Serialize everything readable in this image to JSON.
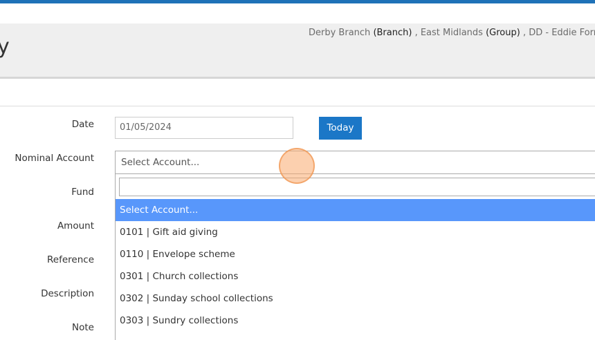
{
  "header": {
    "title_fragment": "y",
    "context": {
      "branch_name": "Derby Branch",
      "branch_tag": "(Branch)",
      "sep1": " , ",
      "group_name": "East Midlands",
      "group_tag": "(Group)",
      "sep2": " , ",
      "user": "DD - Eddie Forrest"
    }
  },
  "form": {
    "labels": {
      "date": "Date",
      "nominal_account": "Nominal Account",
      "fund": "Fund",
      "amount": "Amount",
      "reference": "Reference",
      "description": "Description",
      "note": "Note"
    },
    "date_value": "01/05/2024",
    "today_label": "Today",
    "account_select_value": "Select Account..."
  },
  "dropdown": {
    "search_value": "",
    "options": [
      {
        "label": "Select Account...",
        "highlighted": true
      },
      {
        "label": "0101 | Gift aid giving",
        "highlighted": false
      },
      {
        "label": "0110 | Envelope scheme",
        "highlighted": false
      },
      {
        "label": "0301 | Church collections",
        "highlighted": false
      },
      {
        "label": "0302 | Sunday school collections",
        "highlighted": false
      },
      {
        "label": "0303 | Sundry collections",
        "highlighted": false
      }
    ]
  },
  "colors": {
    "accent": "#1f72b8",
    "button": "#1b77c7",
    "highlight": "#5897fb"
  }
}
